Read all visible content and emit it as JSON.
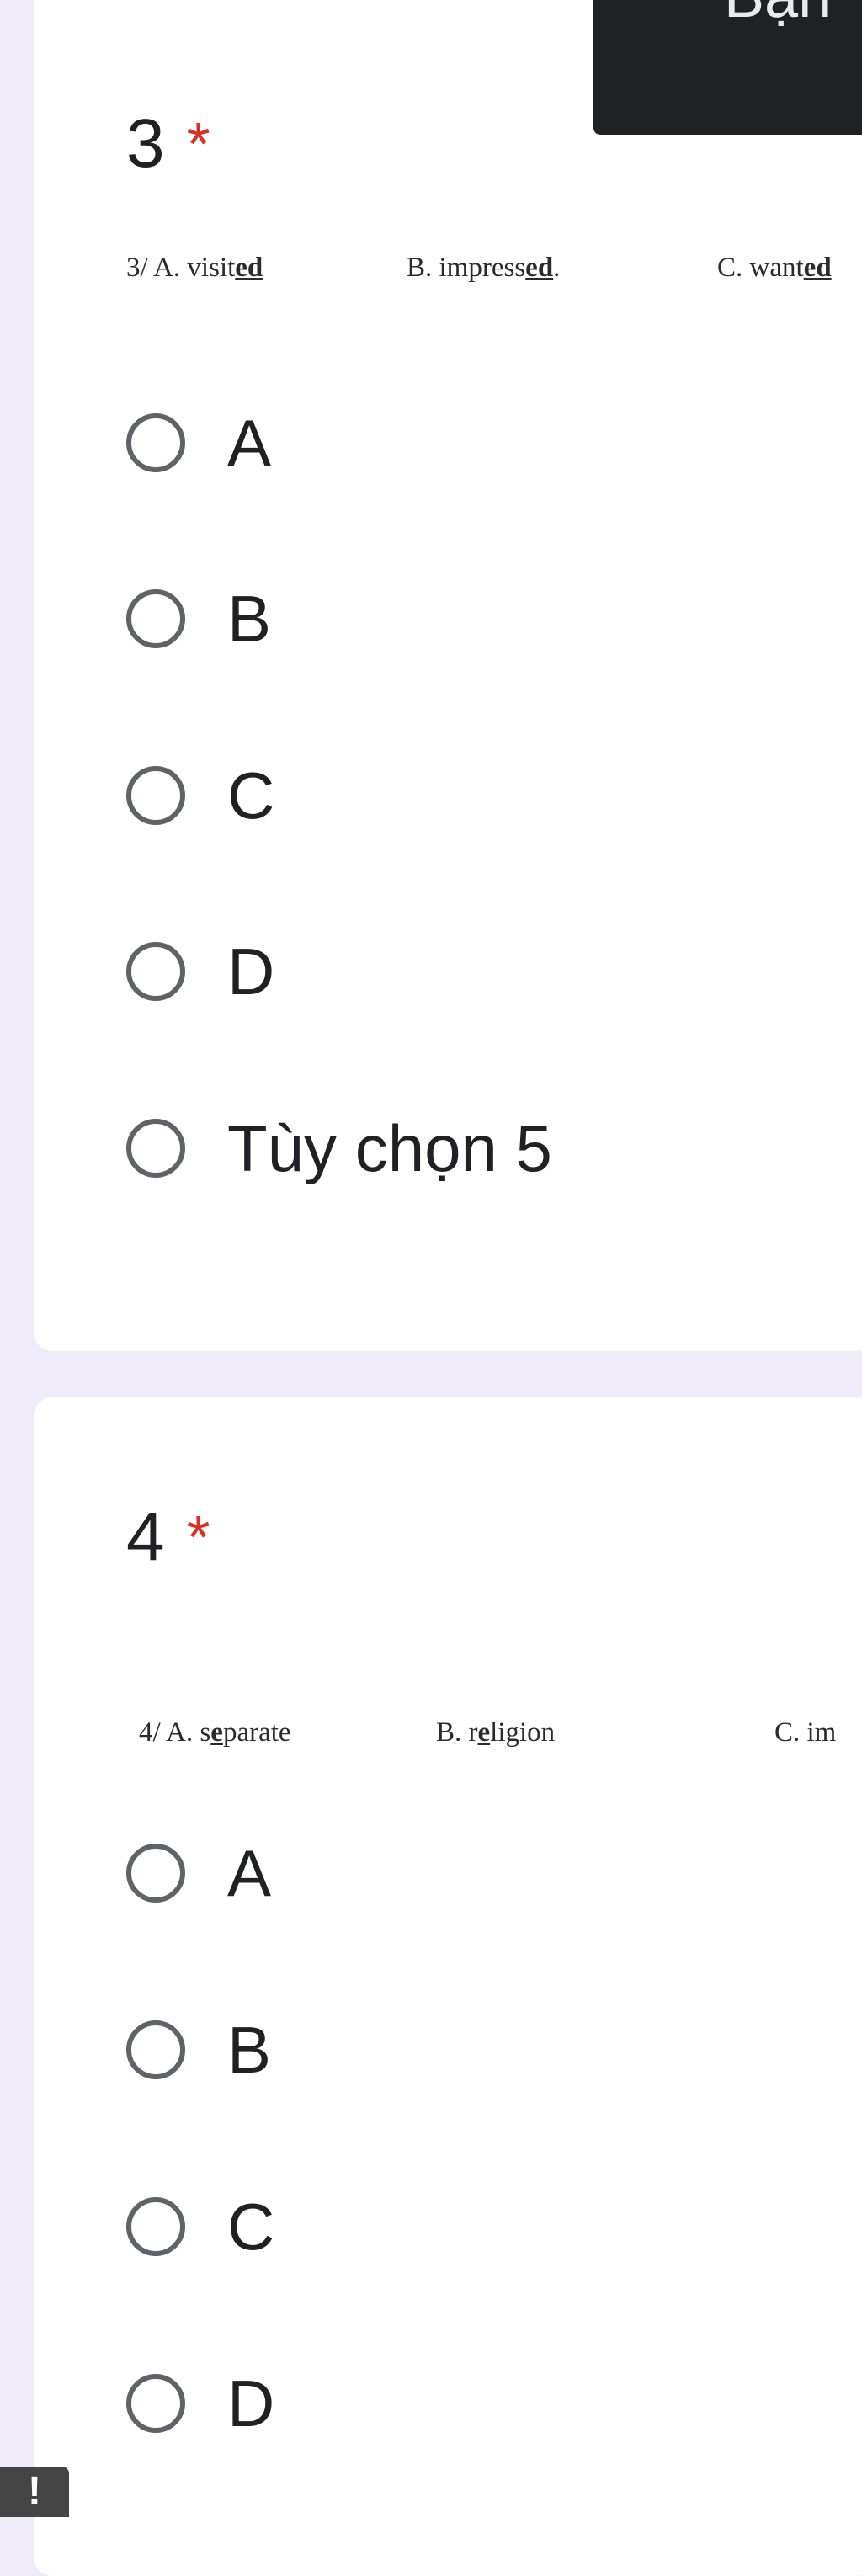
{
  "header": {
    "account_label": "Bạn"
  },
  "questions": [
    {
      "number": "3",
      "required_mark": "*",
      "scan_text": {
        "a": "3/ A. visit",
        "a_ul": "ed",
        "b": "B. impress",
        "b_ul": "ed",
        "b_end": ".",
        "c": "C. want",
        "c_ul": "ed"
      },
      "options": [
        "A",
        "B",
        "C",
        "D",
        "Tùy chọn 5"
      ]
    },
    {
      "number": "4",
      "required_mark": "*",
      "scan_text": {
        "a": "4/ A.  s",
        "a_ul": "e",
        "a_end": "parate",
        "b": "B. r",
        "b_ul": "e",
        "b_end": "ligion",
        "c": "C. im"
      },
      "options": [
        "A",
        "B",
        "C",
        "D"
      ]
    }
  ],
  "alert_icon": "exclamation-icon",
  "alert_glyph": "!"
}
